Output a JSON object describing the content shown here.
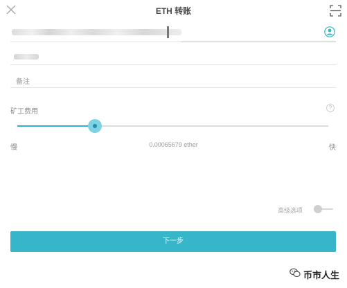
{
  "header": {
    "title": "ETH 转账",
    "close_icon": "close-icon",
    "scan_icon": "scan-qr-icon"
  },
  "form": {
    "contact_icon": "contact-book-icon",
    "memo_placeholder": "备注"
  },
  "fee": {
    "label": "矿工费用",
    "help_icon": "help-icon",
    "slow_label": "慢",
    "fast_label": "快",
    "value": "0.00065679 ether",
    "level_fraction": 0.25
  },
  "advanced": {
    "label": "高级选项",
    "enabled": false
  },
  "next_button": {
    "label": "下一步"
  },
  "watermark": {
    "text": "币市人生"
  },
  "colors": {
    "accent": "#36b6c8",
    "slider_thumb": "#7fd2e3"
  }
}
